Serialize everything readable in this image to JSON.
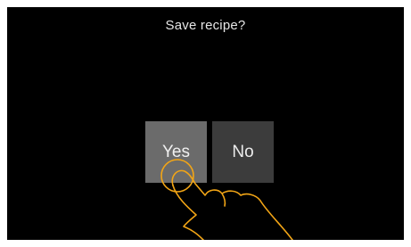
{
  "dialog": {
    "prompt": "Save recipe?",
    "yes_label": "Yes",
    "no_label": "No"
  },
  "colors": {
    "background": "#000000",
    "yes_button": "#6b6b6b",
    "no_button": "#3c3c3c",
    "gesture_hint": "#f2a516"
  },
  "icons": {
    "gesture": "tap-hand-icon"
  }
}
